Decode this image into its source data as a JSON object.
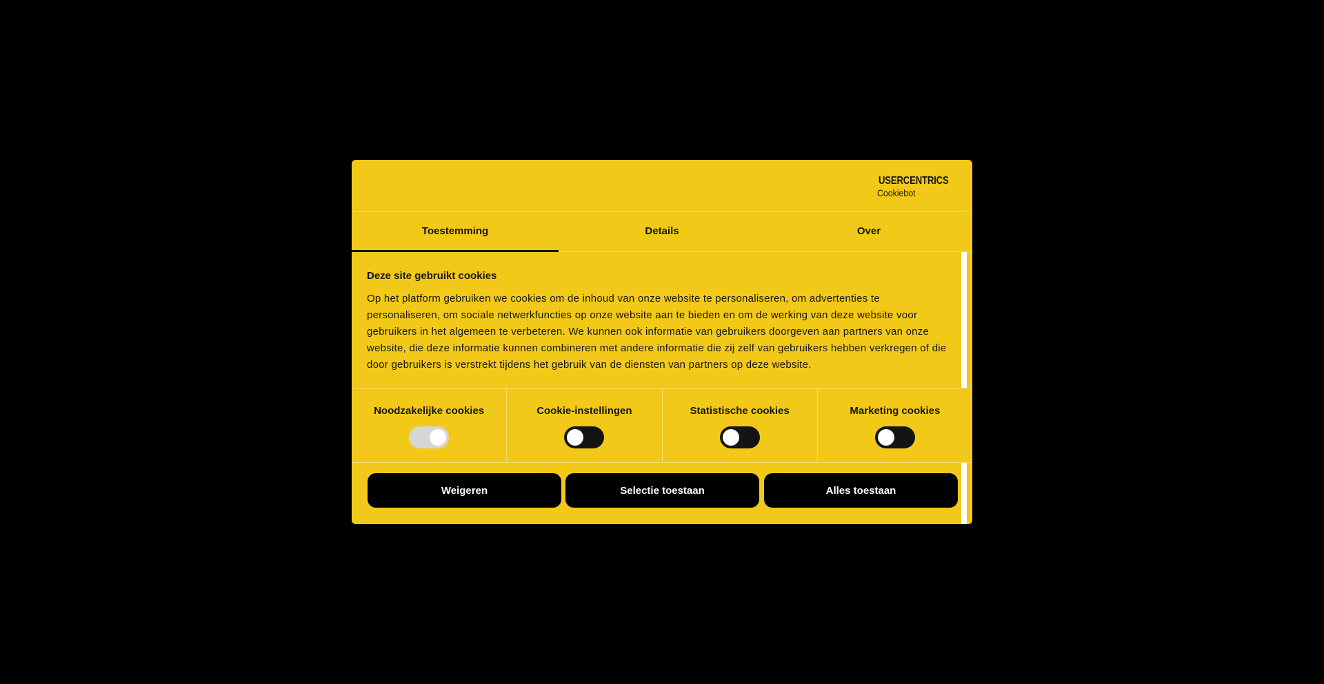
{
  "colors": {
    "backdrop": "#000000",
    "dialog_background": "#f2c918",
    "text": "#141414",
    "button_background": "#000000",
    "button_text": "#ffffff",
    "switch_on_disabled": "#d6d6d6",
    "switch_off": "#141414"
  },
  "logo": {
    "brand": "USERCENTRICS",
    "product": "Cookiebot",
    "icon": "shield-icon"
  },
  "tabs": [
    {
      "label": "Toestemming",
      "active": true
    },
    {
      "label": "Details",
      "active": false
    },
    {
      "label": "Over",
      "active": false
    }
  ],
  "content": {
    "title": "Deze site gebruikt cookies",
    "body": "Op het platform gebruiken we cookies om de inhoud van onze website te personaliseren, om advertenties te personaliseren, om sociale netwerkfuncties op onze website aan te bieden en om de werking van deze website voor gebruikers in het algemeen te verbeteren. We kunnen ook informatie van gebruikers doorgeven aan partners van onze website, die deze informatie kunnen combineren met andere informatie die zij zelf van gebruikers hebben verkregen of die door gebruikers is verstrekt tijdens het gebruik van de diensten van partners op deze website."
  },
  "toggles": [
    {
      "label": "Noodzakelijke cookies",
      "checked": true,
      "disabled": true
    },
    {
      "label": "Cookie-instellingen",
      "checked": false,
      "disabled": false
    },
    {
      "label": "Statistische cookies",
      "checked": false,
      "disabled": false
    },
    {
      "label": "Marketing cookies",
      "checked": false,
      "disabled": false
    }
  ],
  "buttons": {
    "deny": "Weigeren",
    "allow_selection": "Selectie toestaan",
    "allow_all": "Alles toestaan"
  }
}
